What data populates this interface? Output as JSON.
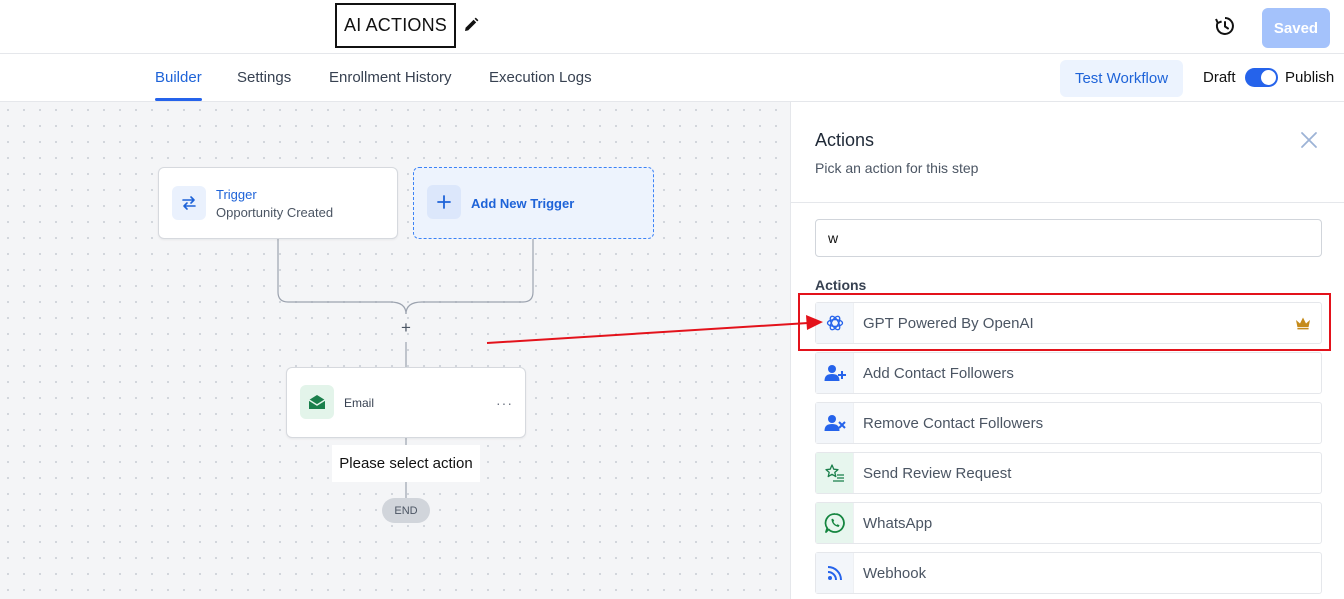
{
  "header": {
    "workflow_title": "AI ACTIONS",
    "save_status": "Saved"
  },
  "tabs": {
    "builder": "Builder",
    "settings": "Settings",
    "enrollment": "Enrollment History",
    "logs": "Execution Logs"
  },
  "toolbar": {
    "test_label": "Test Workflow",
    "draft_label": "Draft",
    "publish_label": "Publish",
    "publish_toggle_on": true
  },
  "canvas": {
    "trigger": {
      "title": "Trigger",
      "subtitle": "Opportunity Created"
    },
    "add_trigger": "Add New Trigger",
    "email_step": "Email",
    "more": "···",
    "please_select": "Please select action",
    "end": "END",
    "plus": "+"
  },
  "panel": {
    "title": "Actions",
    "subtitle": "Pick an action for this step",
    "search_value": "w",
    "section_label": "Actions",
    "items": [
      {
        "label": "GPT Powered By OpenAI",
        "icon": "openai-icon",
        "premium": true
      },
      {
        "label": "Add Contact Followers",
        "icon": "user-plus-icon"
      },
      {
        "label": "Remove Contact Followers",
        "icon": "user-remove-icon"
      },
      {
        "label": "Send Review Request",
        "icon": "star-list-icon"
      },
      {
        "label": "WhatsApp",
        "icon": "whatsapp-icon"
      },
      {
        "label": "Webhook",
        "icon": "rss-icon"
      }
    ]
  },
  "colors": {
    "accent": "#2563eb",
    "annotation": "#e3121b",
    "premium": "#c58b1b"
  }
}
